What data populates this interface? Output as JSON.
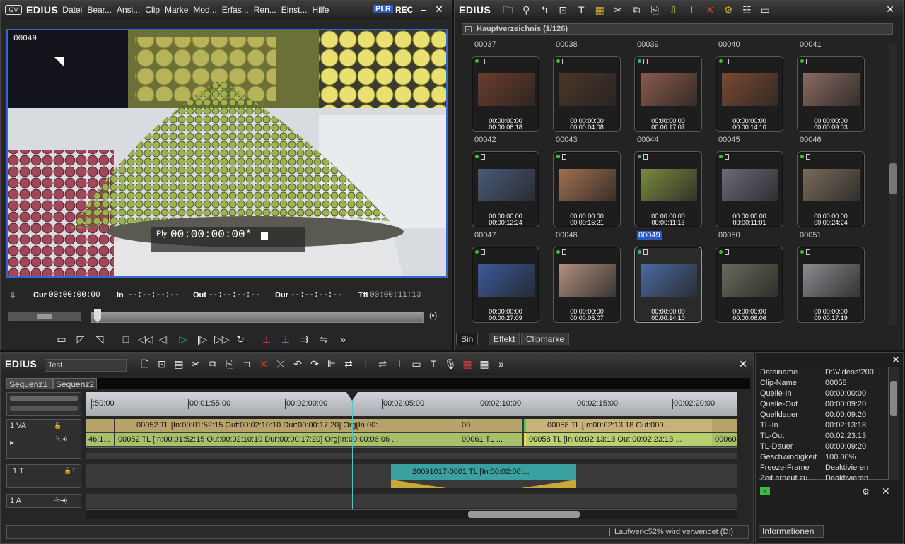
{
  "player": {
    "app": "EDIUS",
    "menu": [
      "Datei",
      "Bear...",
      "Ansi...",
      "Clip",
      "Marke",
      "Mod...",
      "Erfas...",
      "Ren...",
      "Einst...",
      "Hilfe"
    ],
    "badges": [
      "PLR",
      "REC"
    ],
    "clip_id": "00049",
    "overlay_label": "Ply",
    "overlay_tc": "00:00:00:00*",
    "cur_label": "Cur",
    "cur_value": "00:00:00:00",
    "in_label": "In",
    "in_value": "--:--:--:--",
    "out_label": "Out",
    "out_value": "--:--:--:--",
    "dur_label": "Dur",
    "dur_value": "--:--:--:--",
    "ttl_label": "Ttl",
    "ttl_value": "00:00:11:13"
  },
  "bin": {
    "app": "EDIUS",
    "folder": "Hauptverzeichnis (1/126)",
    "rows": [
      {
        "labels": [
          "00037",
          "00038",
          "00039",
          "00040",
          "00041"
        ],
        "clips": [
          {
            "tc1": "00:00:00:00",
            "tc2": "00:00:06:18",
            "color": "#6b3c2a"
          },
          {
            "tc1": "00:00:00:00",
            "tc2": "00:00:04:08",
            "color": "#4a3528"
          },
          {
            "tc1": "00:00:00:00",
            "tc2": "00:00:17:07",
            "color": "#8a5a4a"
          },
          {
            "tc1": "00:00:00:00",
            "tc2": "00:00:14:10",
            "color": "#7a4a30"
          },
          {
            "tc1": "00:00:00:00",
            "tc2": "00:00:09:03",
            "color": "#8a6a60"
          }
        ]
      },
      {
        "labels": [
          "00042",
          "00043",
          "00044",
          "00045",
          "00046"
        ],
        "clips": [
          {
            "tc1": "00:00:00:00",
            "tc2": "00:00:12:24",
            "color": "#4a5a7a"
          },
          {
            "tc1": "00:00:00:00",
            "tc2": "00:00:15:21",
            "color": "#a07050"
          },
          {
            "tc1": "00:00:00:00",
            "tc2": "00:00:11:13",
            "color": "#7a8a40"
          },
          {
            "tc1": "00:00:00:00",
            "tc2": "00:00:11:01",
            "color": "#6a6a7a"
          },
          {
            "tc1": "00:00:00:00",
            "tc2": "00:00:24:24",
            "color": "#7a6a5a"
          }
        ]
      },
      {
        "labels": [
          "00047",
          "00048",
          "00049",
          "00050",
          "00051"
        ],
        "clips": [
          {
            "tc1": "00:00:00:00",
            "tc2": "00:00:27:09",
            "color": "#3a5a9a"
          },
          {
            "tc1": "00:00:00:00",
            "tc2": "00:00:05:07",
            "color": "#b09080"
          },
          {
            "tc1": "00:00:00:00",
            "tc2": "00:00:14:10",
            "color": "#4a6aa0"
          },
          {
            "tc1": "00:00:00:00",
            "tc2": "00:00:06:06",
            "color": "#6a6a5a"
          },
          {
            "tc1": "00:00:00:00",
            "tc2": "00:00:17:19",
            "color": "#8a8a90"
          }
        ]
      }
    ],
    "selected_label": "00049",
    "tabs": [
      "Bin",
      "Effekt",
      "Clipmarke"
    ]
  },
  "timeline": {
    "app": "EDIUS",
    "project": "Test",
    "seq_tabs": [
      "Sequenz1",
      "Sequenz2"
    ],
    "ruler": [
      ":50:00",
      "00:01:55:00",
      "00:02:00:00",
      "00:02:05:00",
      "00:02:10:00",
      "00:02:15:00",
      "00:02:20:00"
    ],
    "tracks": {
      "va": "1 VA",
      "t": "1 T",
      "a": "1 A"
    },
    "va_clips_top": [
      {
        "text": "",
        "color": "#b8a46a"
      },
      {
        "text": "00052  TL [In:00:01:52:15 Out:00:02:10:10 Dur:00:00:17:20]  Org[In:00:...",
        "color": "#b8a46a"
      },
      {
        "text": "00...",
        "color": "#b8a46a"
      },
      {
        "text": "00058  TL [In:00:02:13:18 Out:000...",
        "color": "#b8a46a"
      },
      {
        "text": "",
        "color": "#b8a46a"
      }
    ],
    "va_clips_bottom": [
      {
        "text": "46:1...",
        "color": "#a8c06a"
      },
      {
        "text": "00052  TL [In:00:01:52:15 Out:00:02:10:10 Dur:00:00:17:20]  Org[In:00:00:06:06 ...",
        "color": "#a8c06a"
      },
      {
        "text": "00061  TL ...",
        "color": "#a8c06a"
      },
      {
        "text": "00058  TL [In:00:02:13:18 Out:00:02:23:13 ...",
        "color": "#a8c06a"
      },
      {
        "text": "00060",
        "color": "#a8c06a"
      }
    ],
    "title_clip": "20091017-0001  TL [In:00:02:06:...",
    "status": "Laufwerk:52% wird verwendet (D:)"
  },
  "info": {
    "tab": "Informationen",
    "rows": [
      [
        "Dateiname",
        "D:\\Videos\\200..."
      ],
      [
        "Clip-Name",
        "00058"
      ],
      [
        "Quelle-In",
        "00:00:00:00"
      ],
      [
        "Quelle-Out",
        "00:00:09:20"
      ],
      [
        "Quelldauer",
        "00:00:09:20"
      ],
      [
        "TL-In",
        "00:02:13:18"
      ],
      [
        "TL-Out",
        "00:02:23:13"
      ],
      [
        "TL-Dauer",
        "00:00:09:20"
      ],
      [
        "Geschwindigkeit",
        "100.00%"
      ],
      [
        "Freeze-Frame",
        "Deaktivieren"
      ],
      [
        "Zeit erneut zu...",
        "Deaktivieren"
      ]
    ]
  },
  "colors": {
    "accent": "#3568c8",
    "play": "#3ab8b0",
    "record": "#e03b2a"
  }
}
